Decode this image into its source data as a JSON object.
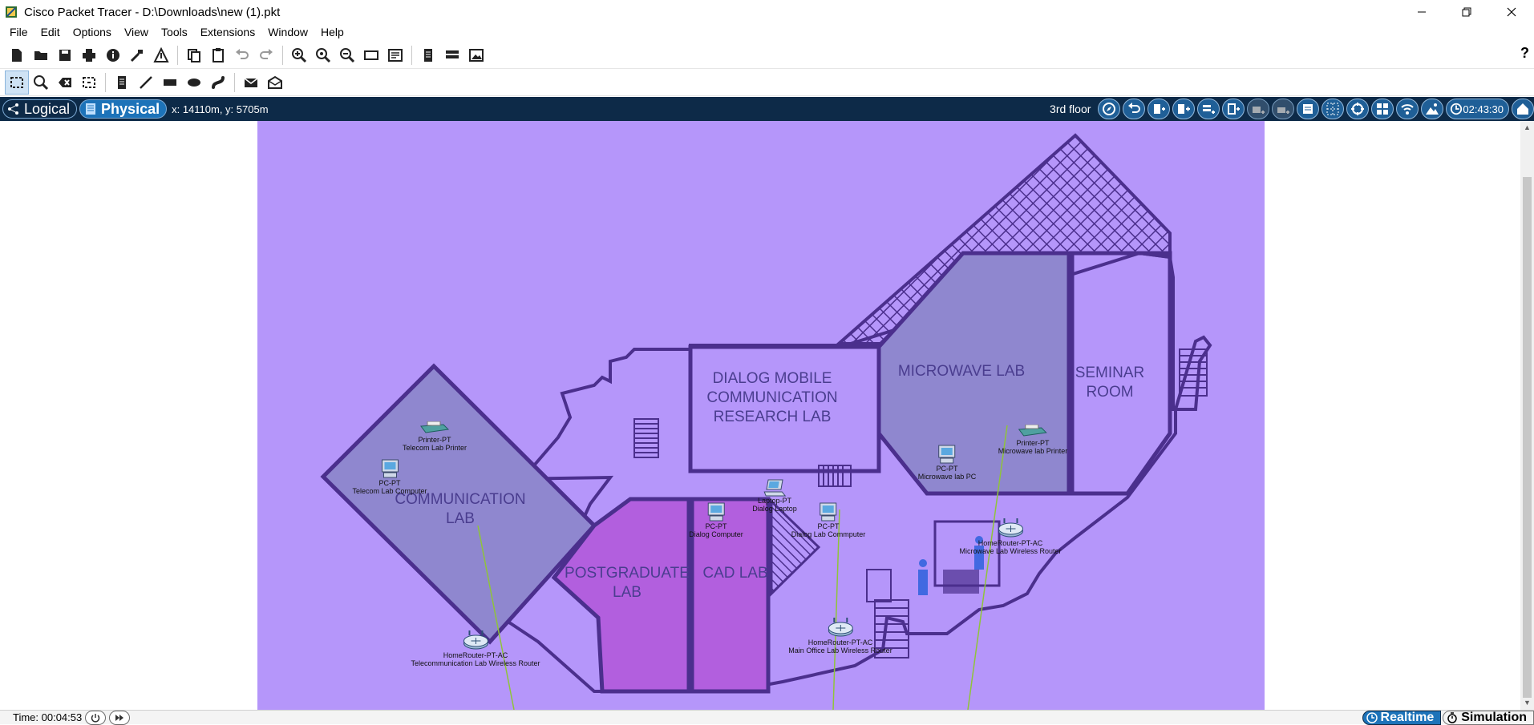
{
  "window": {
    "title": "Cisco Packet Tracer - D:\\Downloads\\new (1).pkt"
  },
  "menu": [
    "File",
    "Edit",
    "Options",
    "View",
    "Tools",
    "Extensions",
    "Window",
    "Help"
  ],
  "toolbar1": {
    "icons": [
      "new-file-icon",
      "open-folder-icon",
      "save-icon",
      "print-icon",
      "info-icon",
      "activity-wizard-icon",
      "custom-device-icon",
      "copy-icon",
      "paste-icon",
      "undo-icon",
      "redo-icon",
      "zoom-in-icon",
      "zoom-reset-icon",
      "zoom-out-icon",
      "drawing-palette-icon",
      "custom-devices-dialog-icon",
      "viewport-icon",
      "cluster-icon",
      "background-image-icon"
    ],
    "help_label": "?"
  },
  "toolbar2": {
    "icons": [
      "select-icon",
      "inspect-icon",
      "delete-icon",
      "resize-shape-icon",
      "note-icon",
      "line-icon",
      "rectangle-icon",
      "ellipse-icon",
      "freeform-icon",
      "simple-pdu-icon",
      "complex-pdu-icon"
    ]
  },
  "workspace": {
    "tab_logical": "Logical",
    "tab_physical": "Physical",
    "coordinates": "x: 14110m, y: 5705m",
    "floor_label": "3rd floor",
    "clock": "02:43:30"
  },
  "rooms": {
    "dialog_mobile": [
      "DIALOG MOBILE",
      "COMMUNICATION",
      "RESEARCH LAB"
    ],
    "microwave": "MICROWAVE LAB",
    "seminar": [
      "SEMINAR",
      "ROOM"
    ],
    "communication": [
      "COMMUNICATION",
      "LAB"
    ],
    "postgraduate": [
      "POSTGRADUATE",
      "LAB"
    ],
    "cad": "CAD LAB"
  },
  "devices": [
    {
      "id": "printer-telecom",
      "type": "Printer-PT",
      "name": "Telecom Lab Printer",
      "icon": "printer-icon"
    },
    {
      "id": "pc-telecom",
      "type": "PC-PT",
      "name": "Telecom Lab Computer",
      "icon": "pc-icon"
    },
    {
      "id": "router-telecom",
      "type": "HomeRouter-PT-AC",
      "name": "Telecommunication Lab Wireless Router",
      "icon": "wireless-router-icon"
    },
    {
      "id": "laptop-dialog",
      "type": "Laptop-PT",
      "name": "Dialog Laptop",
      "icon": "laptop-icon"
    },
    {
      "id": "pc-dialog-1",
      "type": "PC-PT",
      "name": "Dialog Computer",
      "icon": "pc-icon"
    },
    {
      "id": "pc-dialog-2",
      "type": "PC-PT",
      "name": "Dialog Lab Commputer",
      "icon": "pc-icon"
    },
    {
      "id": "router-cad",
      "type": "HomeRouter-PT-AC",
      "name": "Main Office Lab Wireless Router",
      "icon": "wireless-router-icon"
    },
    {
      "id": "pc-microwave",
      "type": "PC-PT",
      "name": "Microwave lab PC",
      "icon": "pc-icon"
    },
    {
      "id": "printer-microwave",
      "type": "Printer-PT",
      "name": "Microwave lab Printer",
      "icon": "printer-icon"
    },
    {
      "id": "router-microwave",
      "type": "HomeRouter-PT-AC",
      "name": "Microwave Lab Wireless Router",
      "icon": "wireless-router-icon"
    }
  ],
  "status": {
    "time": "Time: 00:04:53",
    "realtime_label": "Realtime",
    "simulation_label": "Simulation"
  },
  "colors": {
    "canvas_bg": "#b596fa",
    "wall": "#4b2f8d",
    "room_grey": "#8f87cf",
    "room_magenta": "#b25fde",
    "link_line": "#8fc43a",
    "workspace_bar": "#0d2a48",
    "tab_active": "#1d73b9"
  }
}
